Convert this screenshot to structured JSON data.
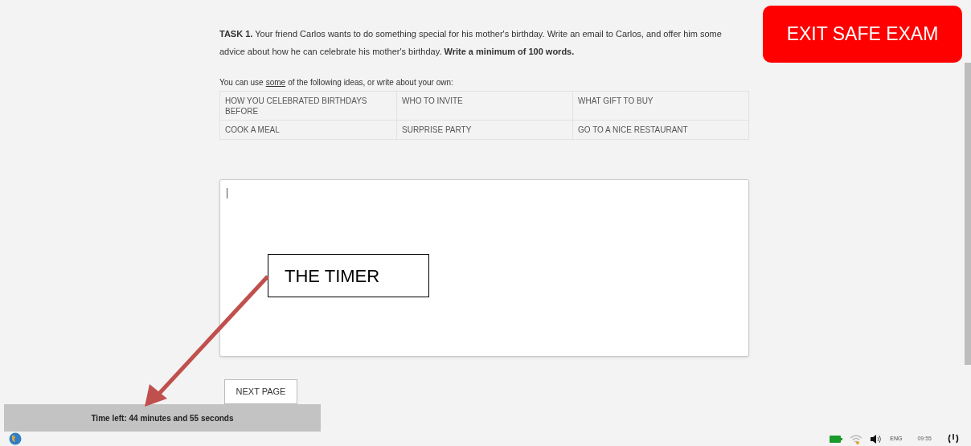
{
  "task": {
    "text": "**TASK 1.** Your friend Carlos wants to do something special for his mother's birthday. Write an email to Carlos, and offer him some advice about how he can celebrate his mother's birthday. **Write a minimum of 100 words.**"
  },
  "ideas_intro": {
    "before": "You can use",
    "underlined": "some",
    "after": "of the following ideas, or write about your own:"
  },
  "ideas": [
    [
      "HOW YOU CELEBRATED BIRTHDAYS BEFORE",
      "WHO TO INVITE",
      "WHAT GIFT TO BUY"
    ],
    [
      "COOK A MEAL",
      "SURPRISE PARTY",
      "GO TO A NICE RESTAURANT"
    ]
  ],
  "next_button": "NEXT PAGE",
  "exit_button": "EXIT SAFE EXAM",
  "timer": "Time left: 44 minutes and 55 seconds",
  "annotation": {
    "label": "THE TIMER"
  },
  "taskbar": {
    "language": "ENG",
    "clock": "09:55"
  }
}
